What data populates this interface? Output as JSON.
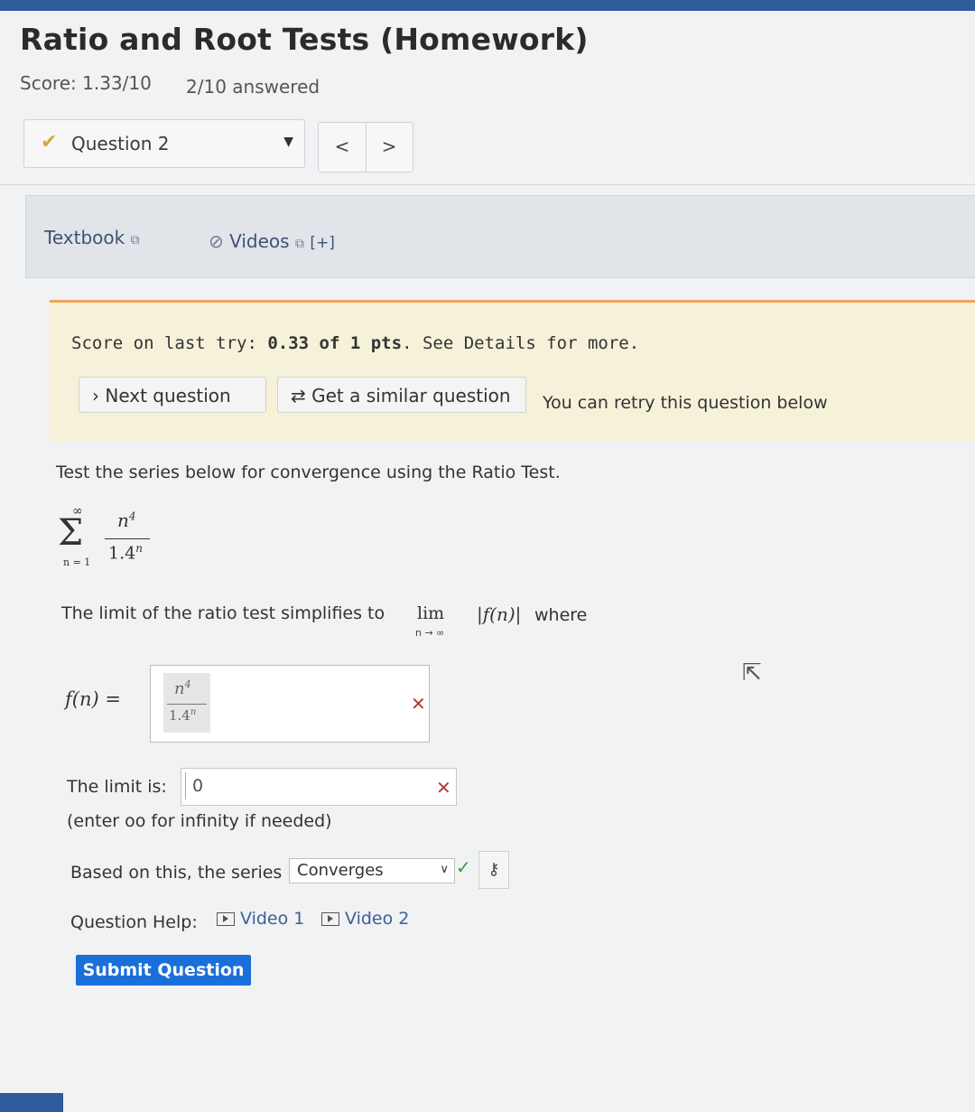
{
  "header": {
    "title": "Ratio and Root Tests (Homework)",
    "score": "Score: 1.33/10",
    "answered": "2/10 answered"
  },
  "question_nav": {
    "current": "Question 2",
    "prev_glyph": "<",
    "next_glyph": ">"
  },
  "resources": {
    "textbook": "Textbook",
    "videos": "Videos",
    "expand": "[+]"
  },
  "notice": {
    "prefix": "Score on last try: ",
    "score_value": "0.33 of 1 pts",
    "suffix": ". See Details for more.",
    "next_question": "Next question",
    "similar_question": "Get a similar question",
    "retry_text": "You can retry this question below"
  },
  "question": {
    "prompt": "Test the series below for convergence using the Ratio Test.",
    "series": {
      "upper": "∞",
      "lower": "n = 1",
      "numerator": "n",
      "numerator_exp": "4",
      "denominator": "1.4",
      "denominator_exp": "n"
    },
    "limit_text": "The limit of the ratio test simplifies to",
    "lim_word": "lim",
    "lim_sub": "n → ∞",
    "lim_expr": "|f(n)|",
    "where": "where",
    "fn_label": "f(n) =",
    "fn_answer": {
      "numerator": "n",
      "numerator_exp": "4",
      "denominator": "1.4",
      "denominator_exp": "n"
    },
    "limit_label": "The limit is:",
    "limit_value": "0",
    "limit_hint": "(enter oo for infinity if needed)",
    "based_label": "Based on this, the series",
    "select_value": "Converges",
    "help_label": "Question Help:",
    "video1": "Video 1",
    "video2": "Video 2",
    "submit": "Submit Question"
  },
  "colors": {
    "accent": "#1a6fd8",
    "notice_bg": "#f6f1d9",
    "notice_border": "#f0a45c",
    "wrong": "#b23a3a",
    "correct": "#3a9a3a"
  }
}
